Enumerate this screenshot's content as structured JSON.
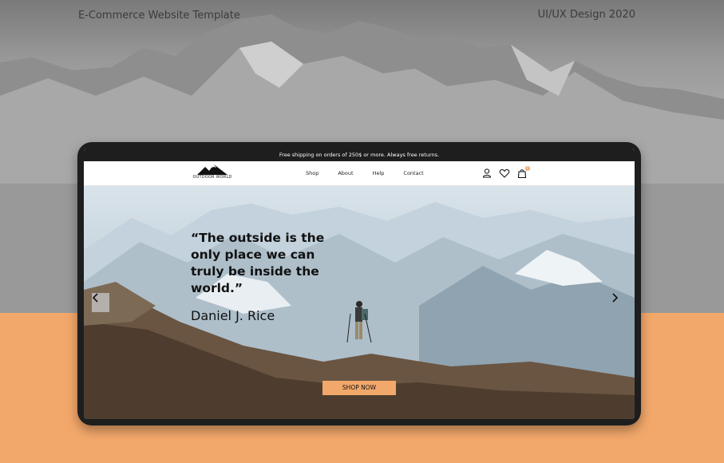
{
  "header": {
    "left_label": "E-Commerce Website Template",
    "right_label": "UI/UX Design 2020"
  },
  "site": {
    "promo_text": "Free shipping on orders of 250$ or more. Always free returns.",
    "logo_text": "OUTDOOR WORLD",
    "nav": [
      "Shop",
      "About",
      "Help",
      "Contact"
    ],
    "icons": [
      "user-icon",
      "heart-icon",
      "cart-icon"
    ],
    "cart_count": "0"
  },
  "hero": {
    "quote_line_1": "“The outside is the",
    "quote_line_2": "only place we can",
    "quote_line_3": "truly be inside the",
    "quote_line_4": "world.”",
    "author": "Daniel J. Rice",
    "cta": "SHOP NOW"
  },
  "colors": {
    "accent": "#f3a86b",
    "dark": "#1e1e1e",
    "text": "#111111"
  }
}
